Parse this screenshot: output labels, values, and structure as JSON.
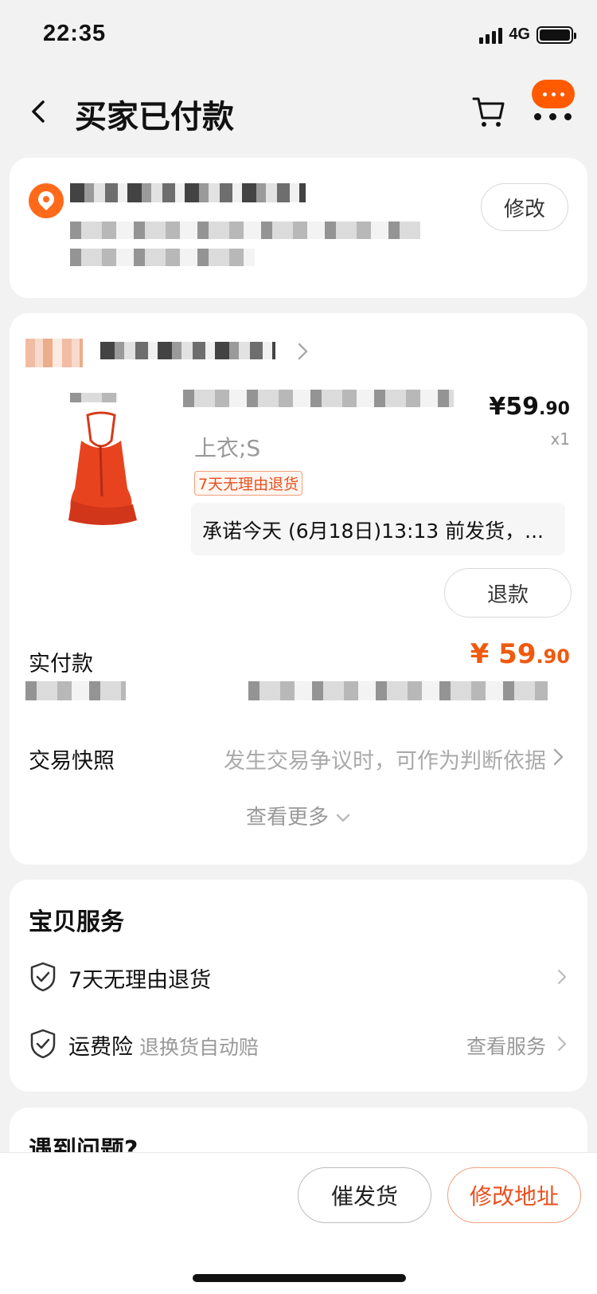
{
  "status": {
    "time": "22:35",
    "network": "4G"
  },
  "nav": {
    "title": "买家已付款"
  },
  "address": {
    "modify_label": "修改"
  },
  "order": {
    "price_symbol": "¥",
    "price_int": "59",
    "price_dec": ".90",
    "quantity": "x1",
    "variant": "上衣;S",
    "return_tag": "7天无理由退货",
    "promise": "承诺今天 (6月18日)13:13 前发货，...",
    "refund_label": "退款",
    "paid_label": "实付款",
    "snapshot_label": "交易快照",
    "snapshot_hint": "发生交易争议时，可作为判断依据",
    "see_more": "查看更多"
  },
  "service": {
    "title": "宝贝服务",
    "items": [
      {
        "label": "7天无理由退货",
        "sub": "",
        "right": ""
      },
      {
        "label": "运费险",
        "sub": "退换货自动赔",
        "right": "查看服务"
      }
    ]
  },
  "problem": {
    "title": "遇到问题?"
  },
  "bottom": {
    "urge_label": "催发货",
    "change_address_label": "修改地址"
  },
  "colors": {
    "accent": "#ee5a0e",
    "brand": "#ff5a00"
  },
  "icons": [
    "back-icon",
    "cart-icon",
    "more-icon",
    "location-pin-icon",
    "chevron-right-icon",
    "chevron-down-icon",
    "shield-check-icon"
  ]
}
